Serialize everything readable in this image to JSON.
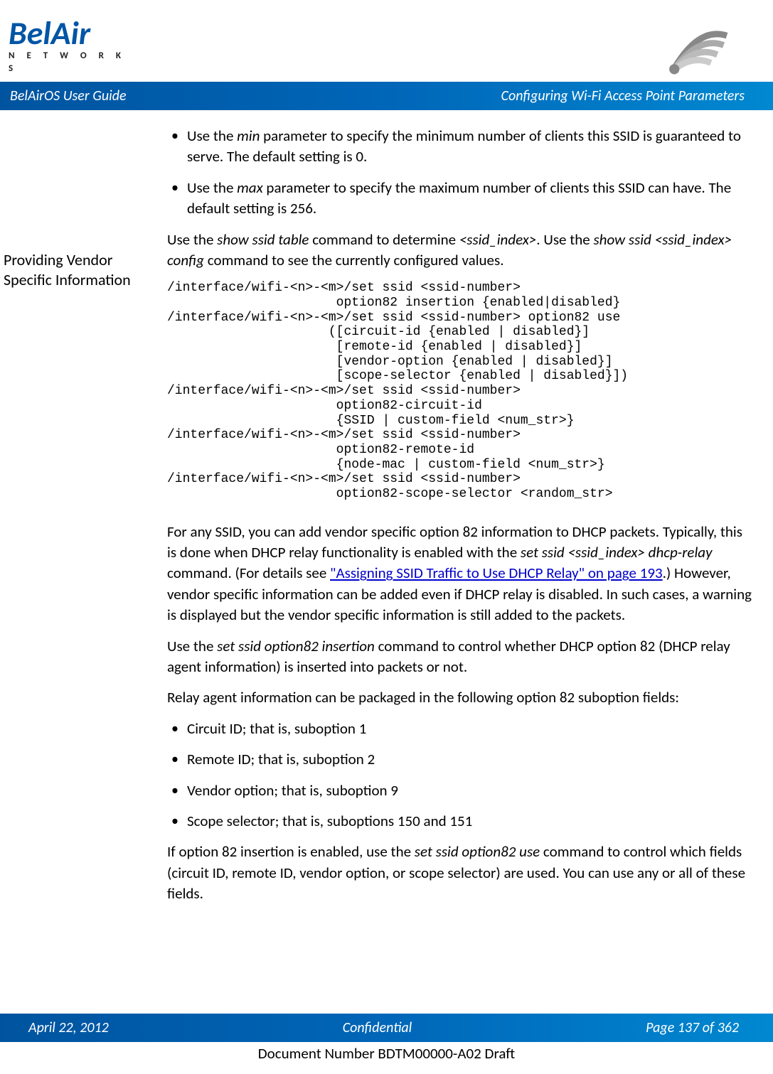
{
  "logo": {
    "brand_top": "BelAir",
    "brand_bottom": "N E T W O R K S"
  },
  "title_bar": {
    "left": "BelAirOS User Guide",
    "right": "Configuring Wi-Fi Access Point Parameters"
  },
  "section_title": "Providing Vendor Specific Information",
  "bullets_top": [
    {
      "prefix": "Use the ",
      "param": "min",
      "rest": " parameter to specify the minimum number of clients this SSID is guaranteed to serve. The default setting is 0."
    },
    {
      "prefix": "Use the ",
      "param": "max",
      "rest": " parameter to specify the maximum number of clients this SSID can have. The default setting is 256."
    }
  ],
  "para_show_ssid": {
    "t1": "Use the ",
    "cmd1": "show ssid table",
    "t2": " command to determine ",
    "arg1": "<ssid_index>",
    "t3": ". Use the ",
    "cmd2": "show ssid <ssid_index> config",
    "t4": " command to see the currently configured values."
  },
  "code": "/interface/wifi-<n>-<m>/set ssid <ssid-number>\n                      option82 insertion {enabled|disabled}\n/interface/wifi-<n>-<m>/set ssid <ssid-number> option82 use\n                     ([circuit-id {enabled | disabled}]\n                      [remote-id {enabled | disabled}]\n                      [vendor-option {enabled | disabled}]\n                      [scope-selector {enabled | disabled}])\n/interface/wifi-<n>-<m>/set ssid <ssid-number>\n                      option82-circuit-id\n                      {SSID | custom-field <num_str>}\n/interface/wifi-<n>-<m>/set ssid <ssid-number>\n                      option82-remote-id\n                      {node-mac | custom-field <num_str>}\n/interface/wifi-<n>-<m>/set ssid <ssid-number>\n                      option82-scope-selector <random_str>",
  "para_vendor": {
    "t1": "For any SSID, you can add vendor specific option 82 information to DHCP packets. Typically, this is done when DHCP relay functionality is enabled with the ",
    "cmd": "set ssid <ssid_index> dhcp-relay",
    "t2": " command. (For details see ",
    "link": "\"Assigning SSID Traffic to Use DHCP Relay\" on page 193",
    "t3": ".) However, vendor specific information can be added even if DHCP relay is disabled. In such cases, a warning is displayed but the vendor specific information is still added to the packets."
  },
  "para_insertion": {
    "t1": "Use the ",
    "cmd": "set ssid option82 insertion",
    "t2": " command to control whether DHCP option 82 (DHCP relay agent information) is inserted into packets or not."
  },
  "para_suboptions_intro": "Relay agent information can be packaged in the following option 82 suboption fields:",
  "suboptions": [
    "Circuit ID; that is, suboption 1",
    "Remote ID; that is, suboption 2",
    "Vendor option; that is, suboption 9",
    "Scope selector; that is, suboptions 150 and 151"
  ],
  "para_use": {
    "t1": "If option 82 insertion is enabled, use the ",
    "cmd": "set ssid option82 use",
    "t2": " command to control which fields (circuit ID, remote ID, vendor option, or scope selector) are used. You can use any or all of these fields."
  },
  "footer": {
    "date": "April 22, 2012",
    "conf": "Confidential",
    "page": "Page 137 of 362"
  },
  "doc_number": "Document Number BDTM00000-A02 Draft"
}
